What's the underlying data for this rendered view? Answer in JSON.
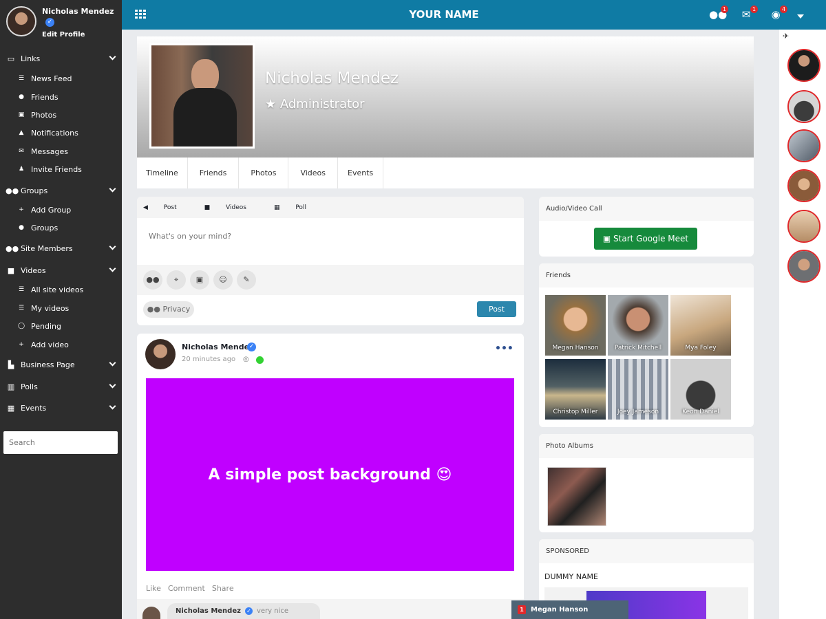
{
  "topbar": {
    "title": "YOUR NAME",
    "friend_requests_badge": "1",
    "messages_badge": "1",
    "notifications_badge": "4"
  },
  "sidebar": {
    "user_name": "Nicholas Mendez",
    "edit_profile": "Edit Profile",
    "sections": [
      {
        "label": "Links",
        "icon": "link-card-icon"
      },
      {
        "label": "Groups",
        "icon": "users-icon"
      },
      {
        "label": "Site Members",
        "icon": "users-icon"
      },
      {
        "label": "Videos",
        "icon": "video-icon"
      },
      {
        "label": "Business Page",
        "icon": "building-icon"
      },
      {
        "label": "Polls",
        "icon": "chart-icon"
      },
      {
        "label": "Events",
        "icon": "calendar-icon"
      }
    ],
    "links": [
      "News Feed",
      "Friends",
      "Photos",
      "Notifications",
      "Messages",
      "Invite Friends"
    ],
    "groups": [
      "Add Group",
      "Groups"
    ],
    "videos": [
      "All site videos",
      "My videos",
      "Pending",
      "Add video"
    ],
    "search_placeholder": "Search"
  },
  "profile": {
    "name": "Nicholas Mendez",
    "role": "Administrator",
    "tabs": [
      "Timeline",
      "Friends",
      "Photos",
      "Videos",
      "Events"
    ]
  },
  "composer": {
    "tabs": [
      "Post",
      "Videos",
      "Poll"
    ],
    "placeholder": "What's on your mind?",
    "privacy": "Privacy",
    "post_button": "Post"
  },
  "post": {
    "author": "Nicholas Mendez",
    "time": "20 minutes ago",
    "background_text": "A simple post background 😍",
    "background_color": "#c000ff",
    "actions": [
      "Like",
      "Comment",
      "Share"
    ],
    "comment_author": "Nicholas Mendez",
    "comment_text": "very nice"
  },
  "widgets": {
    "av_call_title": "Audio/Video Call",
    "meet_button": "Start Google Meet",
    "friends_title": "Friends",
    "friends": [
      "Megan Hanson",
      "Patrick Mitchell",
      "Mya Foley",
      "Christop Miller",
      "Joey Jameson",
      "Keon Daniel"
    ],
    "albums_title": "Photo Albums",
    "sponsored_title": "SPONSORED",
    "sponsored_name": "DUMMY NAME"
  },
  "chat_tab": {
    "name": "Megan Hanson"
  },
  "colors": {
    "topbar": "#0f7ba4",
    "sidebar": "#2d2d2d",
    "meet_button": "#168a3c",
    "post_button": "#2c87ad"
  }
}
